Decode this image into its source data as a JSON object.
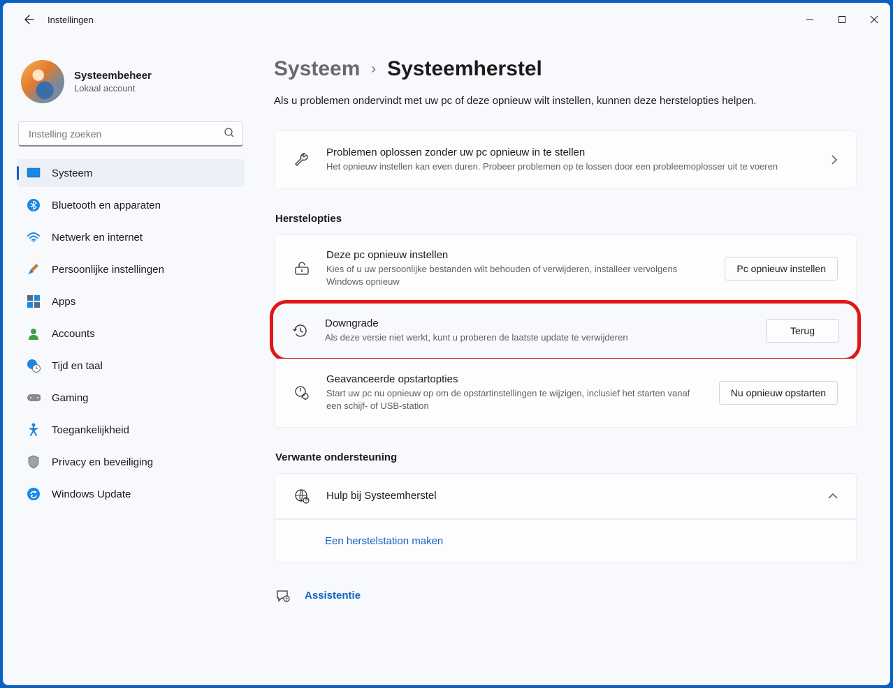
{
  "app": {
    "title": "Instellingen"
  },
  "profile": {
    "name": "Systeembeheer",
    "subtitle": "Lokaal account"
  },
  "search": {
    "placeholder": "Instelling zoeken"
  },
  "nav": [
    {
      "label": "Systeem"
    },
    {
      "label": "Bluetooth en apparaten"
    },
    {
      "label": "Netwerk en internet"
    },
    {
      "label": "Persoonlijke instellingen"
    },
    {
      "label": "Apps"
    },
    {
      "label": "Accounts"
    },
    {
      "label": "Tijd en taal"
    },
    {
      "label": "Gaming"
    },
    {
      "label": "Toegankelijkheid"
    },
    {
      "label": "Privacy en beveiliging"
    },
    {
      "label": "Windows Update"
    }
  ],
  "breadcrumb": {
    "parent": "Systeem",
    "current": "Systeemherstel"
  },
  "description": "Als u problemen ondervindt met uw pc of deze opnieuw wilt instellen, kunnen deze herstelopties helpen.",
  "troubleshoot": {
    "title": "Problemen oplossen zonder uw pc opnieuw in te stellen",
    "subtitle": "Het opnieuw instellen kan even duren. Probeer problemen op te lossen door een probleemoplosser uit te voeren"
  },
  "sections": {
    "recovery": "Herstelopties",
    "support": "Verwante ondersteuning"
  },
  "recovery": {
    "reset": {
      "title": "Deze pc opnieuw instellen",
      "subtitle": "Kies of u uw persoonlijke bestanden wilt behouden of verwijderen, installeer vervolgens Windows opnieuw",
      "button": "Pc opnieuw instellen"
    },
    "downgrade": {
      "title": "Downgrade",
      "subtitle": "Als deze versie niet werkt, kunt u proberen de laatste update te verwijderen",
      "button": "Terug"
    },
    "advanced": {
      "title": "Geavanceerde opstartopties",
      "subtitle": "Start uw pc nu opnieuw op om de opstartinstellingen te wijzigen, inclusief het starten vanaf een schijf- of USB-station",
      "button": "Nu opnieuw opstarten"
    }
  },
  "support": {
    "help": "Hulp bij Systeemherstel",
    "link": "Een herstelstation maken"
  },
  "assistance": "Assistentie"
}
